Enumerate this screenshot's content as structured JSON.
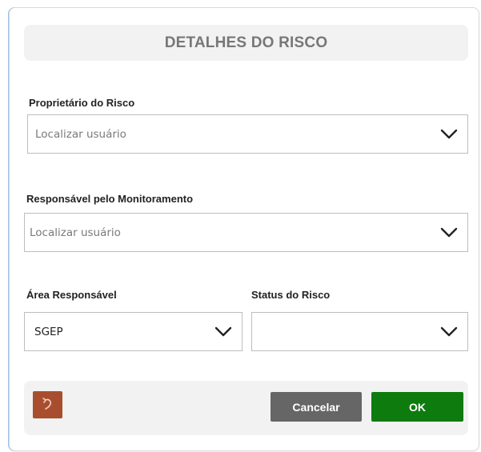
{
  "dialog": {
    "title": "DETALHES DO RISCO"
  },
  "fields": {
    "risk_owner": {
      "label": "Proprietário do Risco",
      "placeholder": "Localizar usuário",
      "value": ""
    },
    "monitoring_responsible": {
      "label": "Responsável pelo Monitoramento",
      "placeholder": "Localizar usuário",
      "value": ""
    },
    "responsible_area": {
      "label": "Área Responsável",
      "value": "SGEP"
    },
    "risk_status": {
      "label": "Status do Risco",
      "value": ""
    }
  },
  "footer": {
    "reset_icon": "undo-icon",
    "cancel_label": "Cancelar",
    "ok_label": "OK"
  },
  "colors": {
    "title_text": "#777777",
    "panel_bg": "#f2f2f2",
    "reset_button": "#a84e2f",
    "cancel_button": "#666666",
    "ok_button": "#0e7b0e"
  }
}
